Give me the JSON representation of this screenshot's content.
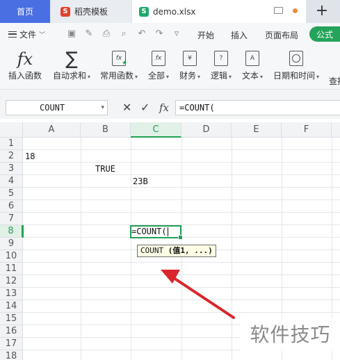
{
  "tabs": {
    "home": "首页",
    "daoke": "稻壳模板",
    "doc": "demo.xlsx"
  },
  "menu": {
    "file": "文件",
    "items": [
      "开始",
      "插入",
      "页面布局"
    ],
    "active": "公式"
  },
  "ribbon": {
    "insert_function": "插入函数",
    "autosum": "自动求和",
    "common_functions": "常用函数",
    "all": "全部",
    "financial": "财务",
    "logical": "逻辑",
    "text": "文本",
    "datetime": "日期和时间",
    "lookup_partial": "查找"
  },
  "formula_bar": {
    "name_box": "COUNT",
    "cancel": "✕",
    "confirm": "✓",
    "fx": "fx",
    "value": "=COUNT("
  },
  "sheet": {
    "columns": [
      "A",
      "B",
      "C",
      "D",
      "E",
      "F"
    ],
    "rows": [
      "1",
      "2",
      "3",
      "4",
      "5",
      "6",
      "7",
      "8",
      "9",
      "10",
      "11",
      "12",
      "13",
      "14",
      "15",
      "16",
      "17",
      "18"
    ],
    "selected_column": "C",
    "selected_row": "8",
    "cells": {
      "A2": "18",
      "B3": "TRUE",
      "C4": "23B",
      "C8": "=COUNT("
    },
    "tooltip_fn": "COUNT",
    "tooltip_arg": "(值1, ...)"
  },
  "watermark": "软件技巧",
  "colors": {
    "accent_green": "#21a053",
    "home_tab": "#4a6fe3",
    "arrow_red": "#d8262b"
  }
}
